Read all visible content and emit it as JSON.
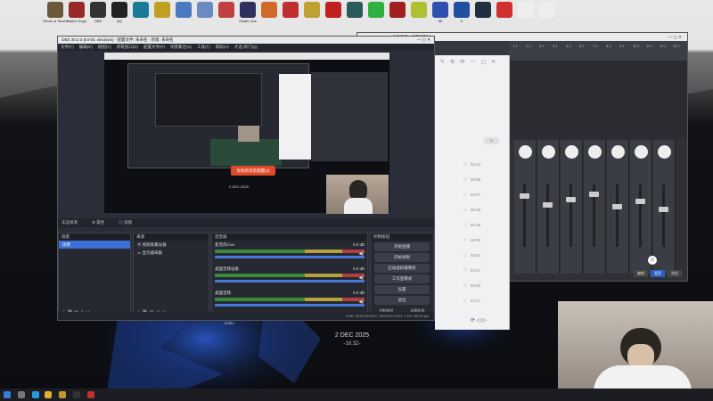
{
  "desktop": {
    "icons": [
      {
        "label": "Ghost of Tsushima",
        "color": "#6a5a3a"
      },
      {
        "label": "Watch Dogs",
        "color": "#9a2a2a"
      },
      {
        "label": "OBS",
        "color": "#333333"
      },
      {
        "label": "QQ",
        "color": "#222222"
      },
      {
        "label": "",
        "color": "#1a7a9a"
      },
      {
        "label": "",
        "color": "#c0a020"
      },
      {
        "label": "",
        "color": "#4a7ac0"
      },
      {
        "label": "",
        "color": "#6a8ac0"
      },
      {
        "label": "",
        "color": "#c04040"
      },
      {
        "label": "Studio One",
        "color": "#303060"
      },
      {
        "label": "",
        "color": "#d06a2a"
      },
      {
        "label": "",
        "color": "#c03030"
      },
      {
        "label": "",
        "color": "#c0a030"
      },
      {
        "label": "",
        "color": "#c02020"
      },
      {
        "label": "",
        "color": "#2a5a5a"
      },
      {
        "label": "",
        "color": "#30b040"
      },
      {
        "label": "",
        "color": "#a02020"
      },
      {
        "label": "",
        "color": "#b0c030"
      },
      {
        "label": "SE",
        "color": "#3050b0"
      },
      {
        "label": "K",
        "color": "#2050a0"
      },
      {
        "label": "",
        "color": "#203040"
      },
      {
        "label": "",
        "color": "#d03030"
      },
      {
        "label": "",
        "color": "#eeeeee"
      },
      {
        "label": "",
        "color": "#eeeeee"
      }
    ],
    "date": "2 DEC 2025",
    "time": "-16:32-"
  },
  "obs": {
    "title": "OBS 30.2.3 (64-bit, windows) - 配置文件: 未命名 - 场景: 未命名",
    "menu": [
      "文件(F)",
      "编辑(E)",
      "视图(V)",
      "停靠窗口(D)",
      "配置文件(P)",
      "场景集合(S)",
      "工具(T)",
      "帮助(H)",
      "才选-新门(Q)"
    ],
    "toolbar": {
      "no_source": "未选择源",
      "props": "属性",
      "filters": "滤镜"
    },
    "overlay_button": "你有新消息提醒(2)",
    "preview_date": "2 DEC 2025",
    "scenes": {
      "header": "场景",
      "items": [
        "场景"
      ]
    },
    "sources": {
      "header": "来源",
      "items": [
        "视频采集设备",
        "显示器采集"
      ]
    },
    "mixer": {
      "header": "混音器",
      "tracks": [
        {
          "name": "麦克风/Aux",
          "db": "0.0 dB"
        },
        {
          "name": "桌面音频设备",
          "db": "0.0 dB"
        },
        {
          "name": "桌面音频",
          "db": "0.0 dB"
        }
      ]
    },
    "controls": {
      "header": "控制按钮",
      "buttons": [
        "开始直播",
        "开始录制",
        "启动虚拟摄像机",
        "工作室模式",
        "设置",
        "退出"
      ],
      "bottom": [
        "控制按钮",
        "场景转场"
      ]
    },
    "status": "LIVE: 00:00:00    REC: 00:00:00    CPU: 1.5%, 60.00 fps"
  },
  "studio_one": {
    "title": "Studio One - 曲目名称 - 混音控制台",
    "ruler": [
      "1.1",
      "2.1",
      "3.1",
      "4.1",
      "5.1",
      "6.1",
      "7.1",
      "8.1",
      "9.1",
      "10.1",
      "11.1",
      "12.1",
      "13.1"
    ],
    "bottom_buttons": [
      "编辑",
      "混音",
      "浏览"
    ]
  },
  "music": {
    "times": [
      "03:24",
      "03:58",
      "04:47",
      "05:00",
      "02:35",
      "04:09",
      "03:51",
      "04:27",
      "03:50",
      "04:17"
    ],
    "user": "Dabu"
  }
}
